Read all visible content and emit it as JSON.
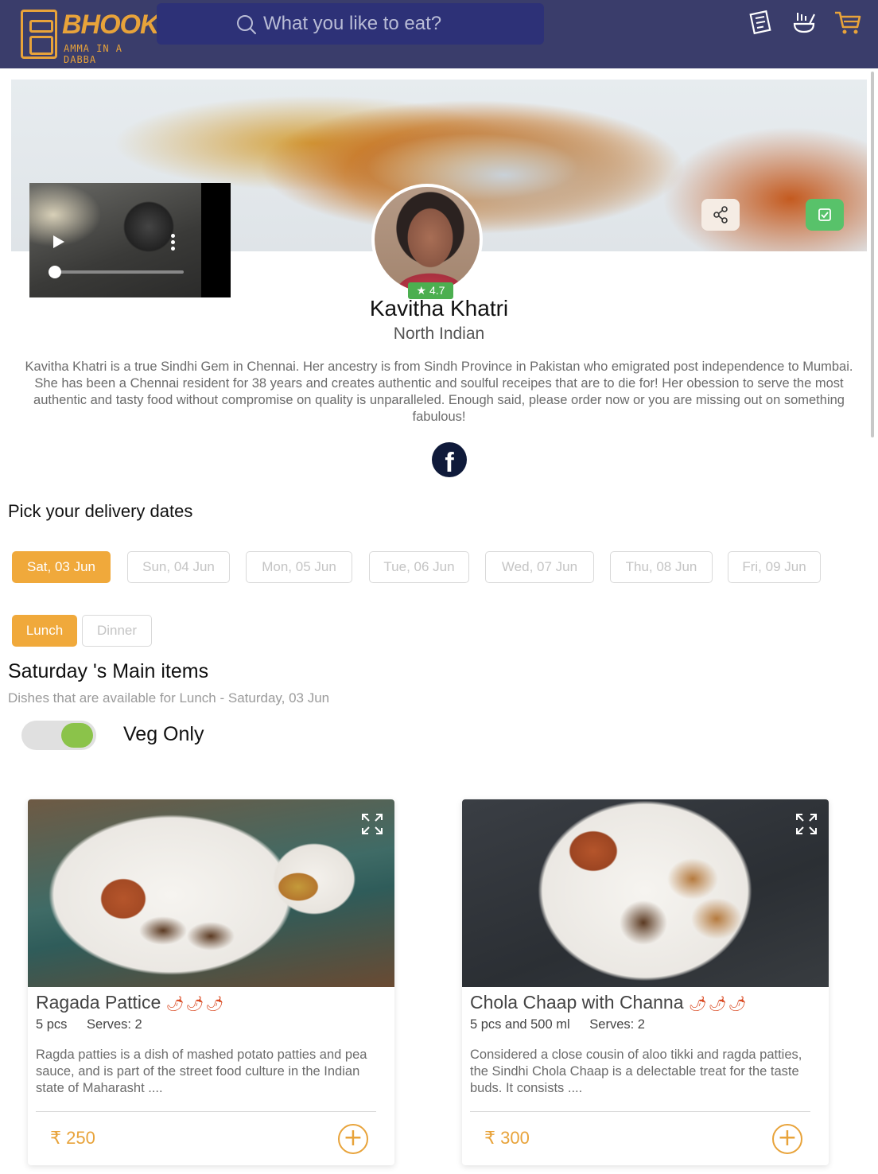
{
  "brand": {
    "name": "BHOOKLE",
    "tagline": "AMMA IN A DABBA",
    "accent": "#e8a33a",
    "header_bg": "#3a3d6b"
  },
  "search": {
    "placeholder": "What you like to eat?"
  },
  "header_icons": [
    "menu-card-icon",
    "chef-hat-icon",
    "cart-icon"
  ],
  "chef": {
    "name": "Kavitha Khatri",
    "cuisine": "North Indian",
    "rating": "4.7",
    "bio": "Kavitha Khatri is a true Sindhi Gem in Chennai. Her ancestry is from Sindh Province in Pakistan who emigrated post independence to Mumbai. She has been a Chennai resident for 38 years and creates authentic and soulful receipes that are to die for! Her obession to serve the most authentic and tasty food without compromise on quality is unparalleled. Enough said, please order now or you are missing out on something fabulous!"
  },
  "social": {
    "facebook_glyph": "f"
  },
  "delivery": {
    "title": "Pick your delivery dates",
    "dates": [
      {
        "label": "Sat, 03 Jun",
        "active": true
      },
      {
        "label": "Sun, 04 Jun",
        "active": false
      },
      {
        "label": "Mon, 05 Jun",
        "active": false
      },
      {
        "label": "Tue, 06 Jun",
        "active": false
      },
      {
        "label": "Wed, 07 Jun",
        "active": false
      },
      {
        "label": "Thu, 08 Jun",
        "active": false
      },
      {
        "label": "Fri, 09 Jun",
        "active": false
      }
    ],
    "meals": [
      {
        "label": "Lunch",
        "active": true
      },
      {
        "label": "Dinner",
        "active": false
      }
    ]
  },
  "menu": {
    "title": "Saturday 's Main items",
    "subtitle": "Dishes that are available for Lunch - Saturday, 03 Jun",
    "veg_only_label": "Veg Only",
    "veg_only": true
  },
  "dishes": [
    {
      "name": "Ragada Pattice",
      "spice": "🌶🌶🌶",
      "quantity": "5 pcs",
      "serves": "Serves: 2",
      "description": "Ragda patties is a dish of mashed potato patties and pea sauce, and is part of the street food culture in the Indian state of Maharasht ....",
      "price": "₹ 250",
      "add_glyph": "+"
    },
    {
      "name": "Chola Chaap with Channa",
      "spice": "🌶🌶🌶",
      "quantity": "5 pcs and 500 ml",
      "serves": "Serves: 2",
      "description": "Considered a close cousin of aloo tikki and ragda patties, the Sindhi Chola Chaap is a delectable treat for the taste buds. It consists ....",
      "price": "₹ 300",
      "add_glyph": "+"
    }
  ]
}
